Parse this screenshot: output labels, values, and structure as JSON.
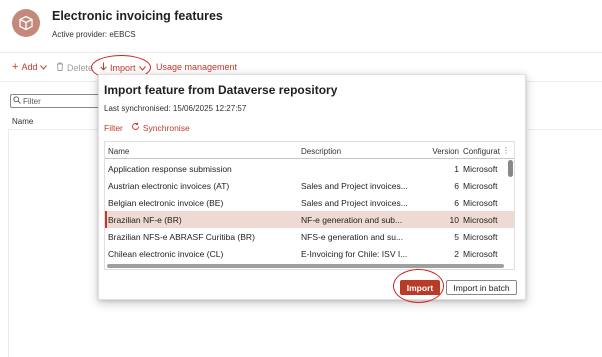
{
  "header": {
    "title": "Electronic invoicing features",
    "provider": "Active provider: eEBCS",
    "icon": "package-icon"
  },
  "toolbar": {
    "add_label": "Add",
    "delete_label": "Delete",
    "import_label": "Import",
    "usage_label": "Usage management"
  },
  "background": {
    "filter_placeholder": "Filter",
    "name_header": "Name"
  },
  "dialog": {
    "title": "Import feature from Dataverse repository",
    "last_sync": "Last synchronised: 15/06/2025 12:27:57",
    "filter_label": "Filter",
    "sync_label": "Synchronise",
    "columns": {
      "name": "Name",
      "description": "Description",
      "version": "Version",
      "configuration": "Configurat"
    },
    "rows": [
      {
        "name": "Application response submission",
        "description": "",
        "version": "1",
        "configuration": "Microsoft"
      },
      {
        "name": "Austrian electronic invoices (AT)",
        "description": "Sales and Project invoices...",
        "version": "6",
        "configuration": "Microsoft"
      },
      {
        "name": "Belgian electronic invoice (BE)",
        "description": "Sales and Project invoices...",
        "version": "6",
        "configuration": "Microsoft"
      },
      {
        "name": "Brazilian NF-e (BR)",
        "description": "NF-e generation and sub...",
        "version": "10",
        "configuration": "Microsoft"
      },
      {
        "name": "Brazilian NFS-e ABRASF Curitiba (BR)",
        "description": "NFS-e generation and su...",
        "version": "5",
        "configuration": "Microsoft"
      },
      {
        "name": "Chilean electronic invoice (CL)",
        "description": "E-Invoicing for Chile: ISV I...",
        "version": "2",
        "configuration": "Microsoft"
      }
    ],
    "selected_row_index": 3,
    "import_button": "Import",
    "import_batch_button": "Import in batch"
  },
  "colors": {
    "accent": "#c13a2b",
    "primary_button": "#b83b27",
    "selected_row": "#eed9d3",
    "annotation": "#d12222"
  }
}
